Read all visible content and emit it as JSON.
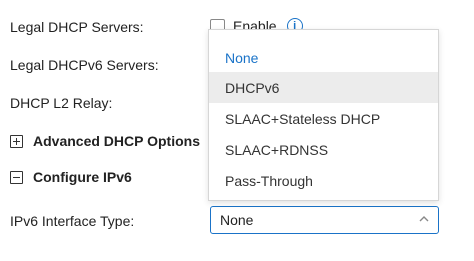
{
  "form": {
    "legal_dhcp_servers_label": "Legal DHCP Servers:",
    "enable_label": "Enable",
    "legal_dhcpv6_servers_label": "Legal DHCPv6 Servers:",
    "dhcp_l2_relay_label": "DHCP L2 Relay:",
    "advanced_dhcp_options_label": "Advanced DHCP Options",
    "configure_ipv6_label": "Configure IPv6",
    "ipv6_interface_type_label": "IPv6 Interface Type:",
    "ipv6_interface_type_value": "None"
  },
  "dropdown": {
    "options": [
      {
        "label": "None",
        "selected": true
      },
      {
        "label": "DHCPv6",
        "hovered": true
      },
      {
        "label": "SLAAC+Stateless DHCP"
      },
      {
        "label": "SLAAC+RDNSS"
      },
      {
        "label": "Pass-Through"
      }
    ]
  },
  "icons": {
    "info": "info-icon",
    "expand": "plus-icon",
    "collapse": "minus-icon",
    "chevron": "chevron-up-icon"
  },
  "colors": {
    "accent": "#1a73c8",
    "hover_bg": "#ececec",
    "text": "#222222"
  }
}
